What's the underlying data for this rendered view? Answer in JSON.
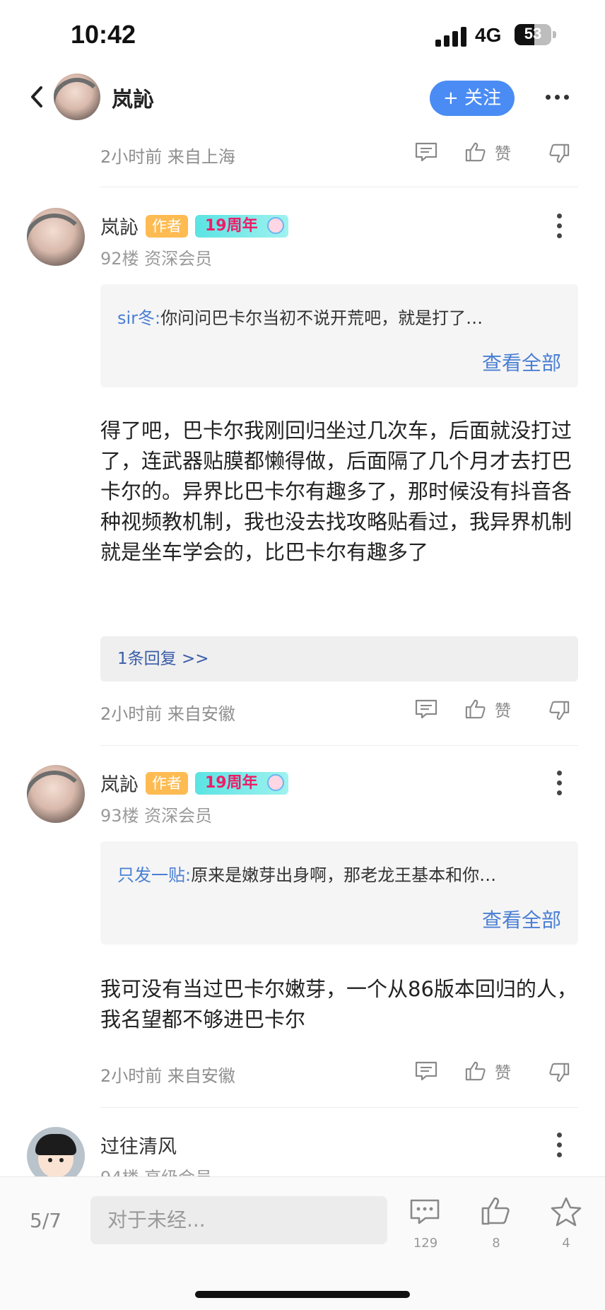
{
  "status_bar": {
    "time": "10:42",
    "network": "4G",
    "battery": "53"
  },
  "header": {
    "username": "岚訫",
    "follow_label": "+ 关注"
  },
  "post_top": {
    "meta": "2小时前 来自上海",
    "like_label": "赞"
  },
  "posts": [
    {
      "author": "岚訫",
      "author_badge": "作者",
      "anniversary_badge": "19周年",
      "floor": "92楼 资深会员",
      "quote_user": "sir冬:",
      "quote_text": "你问问巴卡尔当初不说开荒吧，就是打了…",
      "view_all": "查看全部",
      "text": "得了吧，巴卡尔我刚回归坐过几次车，后面就没打过了，连武器贴膜都懒得做，后面隔了几个月才去打巴卡尔的。异界比巴卡尔有趣多了，那时候没有抖音各种视频教机制，我也没去找攻略贴看过，我异界机制就是坐车学会的，比巴卡尔有趣多了",
      "replies": "1条回复 >>",
      "meta": "2小时前 来自安徽",
      "like_label": "赞"
    },
    {
      "author": "岚訫",
      "author_badge": "作者",
      "anniversary_badge": "19周年",
      "floor": "93楼 资深会员",
      "quote_user": "只发一贴:",
      "quote_text": "原来是嫩芽出身啊，那老龙王基本和你…",
      "view_all": "查看全部",
      "text": "我可没有当过巴卡尔嫩芽，一个从86版本回归的人，我名望都不够进巴卡尔",
      "meta": "2小时前 来自安徽",
      "like_label": "赞"
    },
    {
      "author": "过往清风",
      "floor": "94楼 高级会员"
    }
  ],
  "bottom_bar": {
    "page": "5/7",
    "input_placeholder": "对于未经...",
    "comment_count": "129",
    "like_count": "8",
    "favorite_count": "4"
  },
  "colors": {
    "accent": "#4a8cf4",
    "link": "#4a7fd4",
    "author_badge": "#fdbb52"
  }
}
